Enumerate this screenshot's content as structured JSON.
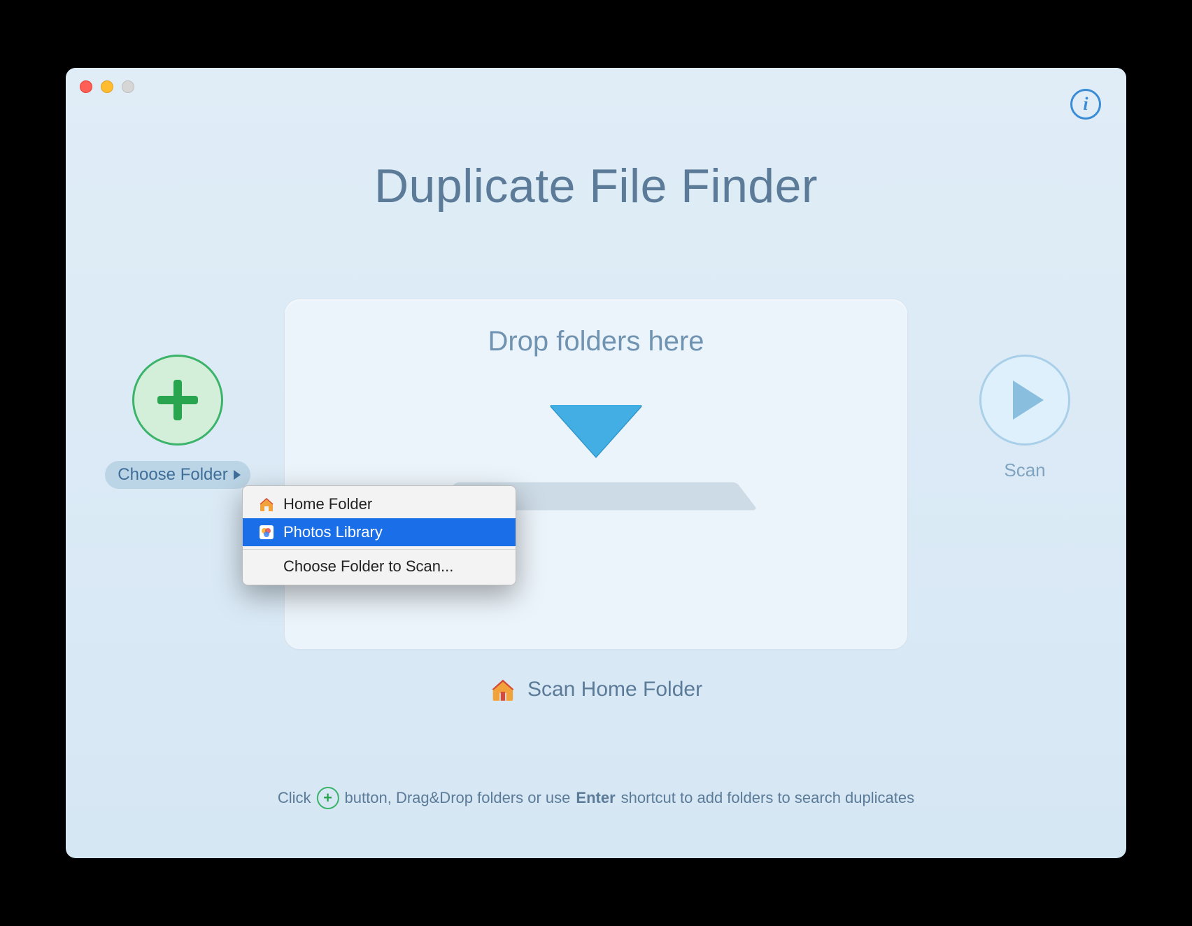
{
  "app": {
    "title": "Duplicate File Finder"
  },
  "drop": {
    "title": "Drop folders here"
  },
  "add": {
    "choose_label": "Choose Folder"
  },
  "scan": {
    "button_label": "Scan",
    "home_label": "Scan Home Folder"
  },
  "menu": {
    "items": [
      {
        "label": "Home Folder",
        "icon": "home-icon"
      },
      {
        "label": "Photos Library",
        "icon": "photos-icon",
        "selected": true
      }
    ],
    "choose_label": "Choose Folder to Scan..."
  },
  "hint": {
    "pre": "Click",
    "mid": "button, Drag&Drop folders or use",
    "bold": "Enter",
    "post": "shortcut to add folders to search duplicates"
  },
  "colors": {
    "accent_blue": "#3a8cd6",
    "accent_green": "#2aa54f",
    "bg_gradient_top": "#e0edf7",
    "bg_gradient_bottom": "#d6e7f4",
    "selection_blue": "#1a6fe8"
  }
}
